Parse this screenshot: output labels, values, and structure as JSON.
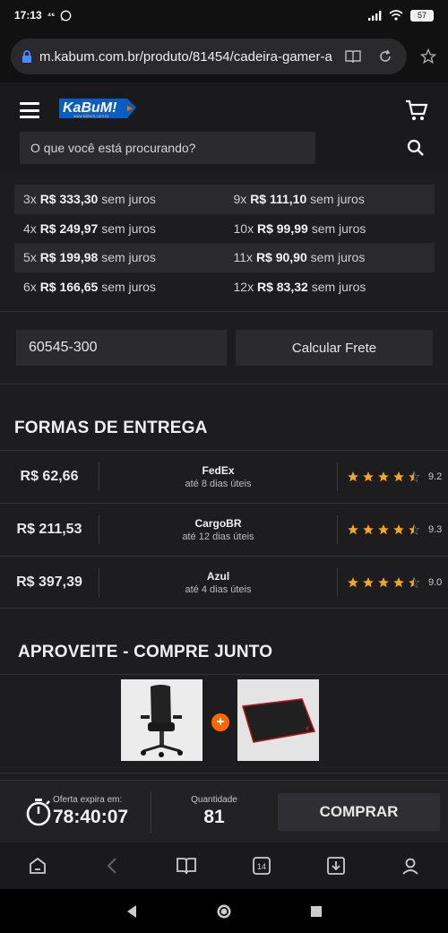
{
  "status_bar": {
    "time": "17:13",
    "extra": "⁴⁶",
    "battery": "57"
  },
  "browser": {
    "url": "m.kabum.com.br/produto/81454/cadeira-gamer-a"
  },
  "header": {
    "logo_text": "KaBuM!",
    "logo_sub": "www.kabum.com.br",
    "search_placeholder": "O que você está procurando?"
  },
  "installments": [
    [
      {
        "count": "3x",
        "price": "R$ 333,30",
        "note": "sem juros"
      },
      {
        "count": "9x",
        "price": "R$ 111,10",
        "note": "sem juros"
      }
    ],
    [
      {
        "count": "4x",
        "price": "R$ 249,97",
        "note": "sem juros"
      },
      {
        "count": "10x",
        "price": "R$ 99,99",
        "note": "sem juros"
      }
    ],
    [
      {
        "count": "5x",
        "price": "R$ 199,98",
        "note": "sem juros"
      },
      {
        "count": "11x",
        "price": "R$ 90,90",
        "note": "sem juros"
      }
    ],
    [
      {
        "count": "6x",
        "price": "R$ 166,65",
        "note": "sem juros"
      },
      {
        "count": "12x",
        "price": "R$ 83,32",
        "note": "sem juros"
      }
    ]
  ],
  "freight": {
    "cep_value": "60545-300",
    "calc_label": "Calcular Frete"
  },
  "delivery": {
    "title": "FORMAS DE ENTREGA",
    "options": [
      {
        "price": "R$ 62,66",
        "carrier": "FedEx",
        "days": "até 8 dias úteis",
        "rating": "9.2",
        "stars": 4.5
      },
      {
        "price": "R$ 211,53",
        "carrier": "CargoBR",
        "days": "até 12 dias úteis",
        "rating": "9.3",
        "stars": 4.5
      },
      {
        "price": "R$ 397,39",
        "carrier": "Azul",
        "days": "até 4 dias úteis",
        "rating": "9.0",
        "stars": 4.5
      }
    ]
  },
  "combo": {
    "title": "APROVEITE - COMPRE JUNTO",
    "plus": "+"
  },
  "bottom_bar": {
    "timer_label": "Oferta expira em:",
    "timer_value": "78:40:07",
    "qty_label": "Quantidade",
    "qty_value": "81",
    "buy_label": "COMPRAR"
  },
  "browser_nav": {
    "tabs_count": "14"
  },
  "colors": {
    "accent": "#ff6500",
    "star": "#f5a623",
    "logo_blue": "#0a5ec2"
  }
}
